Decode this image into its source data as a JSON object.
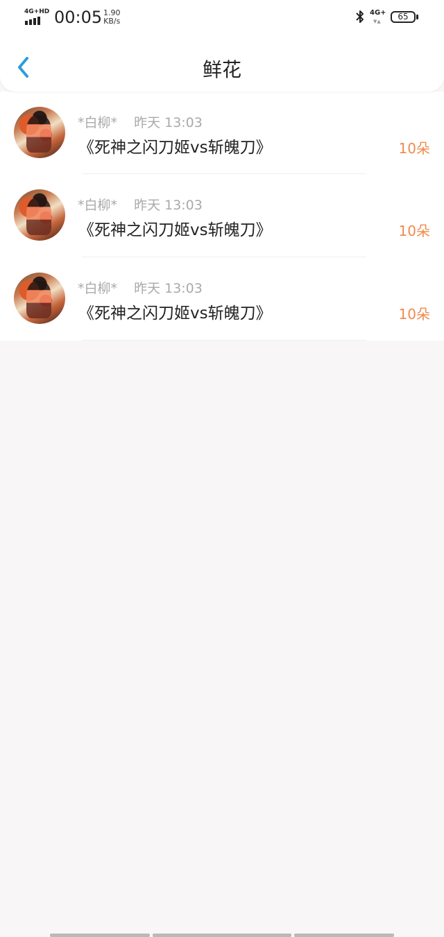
{
  "status_bar": {
    "network_label": "4G+HD",
    "time": "00:05",
    "speed_value": "1.90",
    "speed_unit": "KB/s",
    "cell_label": "4G+",
    "battery": "65"
  },
  "header": {
    "title": "鲜花"
  },
  "records": [
    {
      "user": "*白柳*",
      "time": "昨天 13:03",
      "book": "《死神之闪刀姬vs斩魄刀》",
      "amount": "10朵"
    },
    {
      "user": "*白柳*",
      "time": "昨天 13:03",
      "book": "《死神之闪刀姬vs斩魄刀》",
      "amount": "10朵"
    },
    {
      "user": "*白柳*",
      "time": "昨天 13:03",
      "book": "《死神之闪刀姬vs斩魄刀》",
      "amount": "10朵"
    }
  ],
  "colors": {
    "accent_blue": "#2d9cdb",
    "amount_orange": "#f08a4b",
    "background": "#f8f6f7"
  },
  "icons": {
    "back": "back-chevron-icon",
    "bluetooth": "bluetooth-icon",
    "signal": "signal-icon",
    "battery": "battery-icon"
  }
}
